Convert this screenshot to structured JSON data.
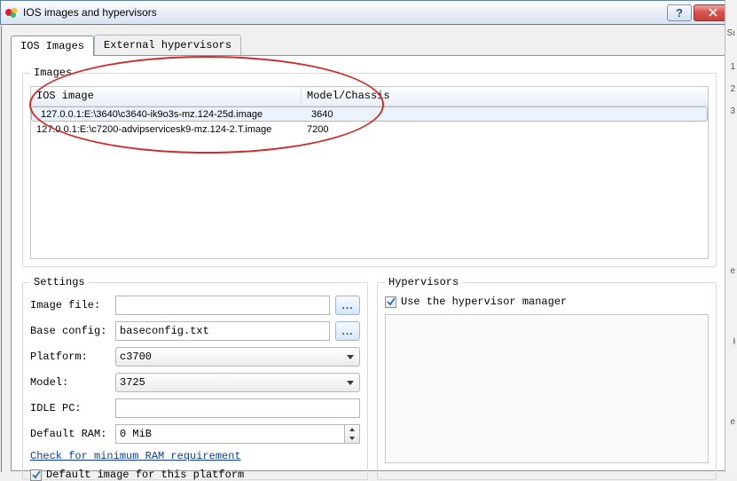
{
  "window": {
    "title": "IOS images and hypervisors"
  },
  "tabs": {
    "ios": "IOS Images",
    "ext": "External hypervisors"
  },
  "images_group": {
    "legend": "Images",
    "headers": {
      "image": "IOS image",
      "model": "Model/Chassis"
    },
    "rows": [
      {
        "image": "127.0.0.1:E:\\3640\\c3640-ik9o3s-mz.124-25d.image",
        "model": "3640"
      },
      {
        "image": "127.0.0.1:E:\\c7200-advipservicesk9-mz.124-2.T.image",
        "model": "7200"
      }
    ]
  },
  "settings": {
    "legend": "Settings",
    "labels": {
      "image_file": "Image file:",
      "base_config": "Base config:",
      "platform": "Platform:",
      "model": "Model:",
      "idle_pc": "IDLE PC:",
      "default_ram": "Default RAM:"
    },
    "values": {
      "image_file": "",
      "base_config": "baseconfig.txt",
      "platform": "c3700",
      "model": "3725",
      "idle_pc": "",
      "default_ram": "0 MiB"
    },
    "browse": "...",
    "link": "Check for minimum RAM requirement",
    "default_image": "Default image for this platform"
  },
  "hypervisors": {
    "legend": "Hypervisors",
    "use_manager": "Use the hypervisor manager"
  },
  "rightstrip": [
    "Sı",
    "1",
    "2",
    "3",
    "e",
    "ł",
    "e"
  ]
}
